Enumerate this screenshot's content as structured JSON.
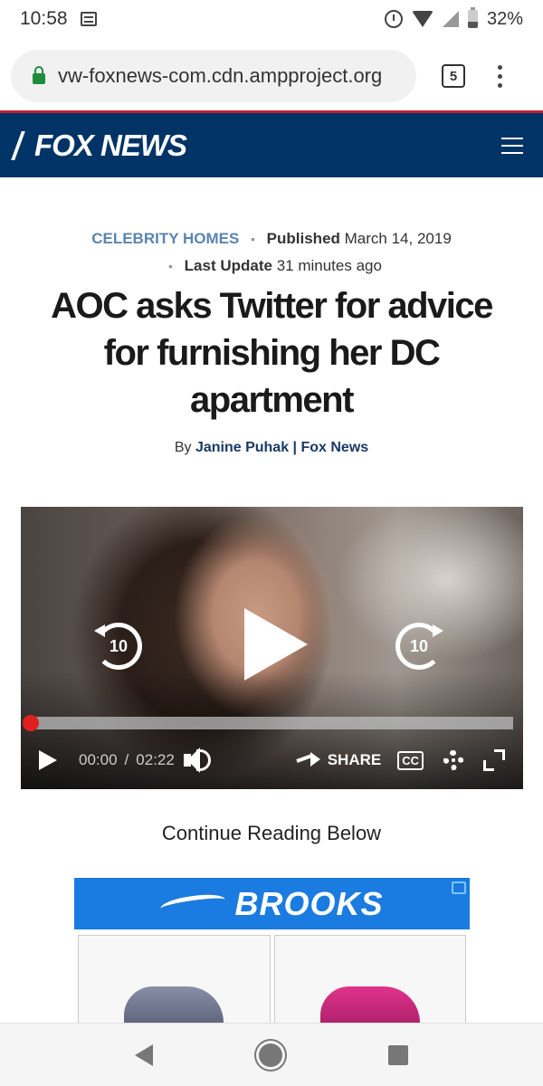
{
  "status": {
    "time": "10:58",
    "battery": "32%"
  },
  "browser": {
    "url": "vw-foxnews-com.cdn.ampproject.org",
    "tab_count": "5"
  },
  "site": {
    "logo": "FOX NEWS"
  },
  "article": {
    "category": "CELEBRITY HOMES",
    "published_label": "Published",
    "published_date": "March 14, 2019",
    "updated_label": "Last Update",
    "updated_value": "31 minutes ago",
    "headline": "AOC asks Twitter for advice for furnishing her DC apartment",
    "by_label": "By",
    "author": "Janine Puhak | Fox News"
  },
  "video": {
    "rewind_label": "10",
    "forward_label": "10",
    "current_time": "00:00",
    "time_separator": "/",
    "duration": "02:22",
    "share_label": "SHARE",
    "cc_label": "CC",
    "progress": 0
  },
  "continue_text": "Continue Reading Below",
  "ad": {
    "brand": "BROOKS"
  },
  "colors": {
    "header": "#003366",
    "accent": "#c0202f",
    "category": "#5b84b1"
  }
}
